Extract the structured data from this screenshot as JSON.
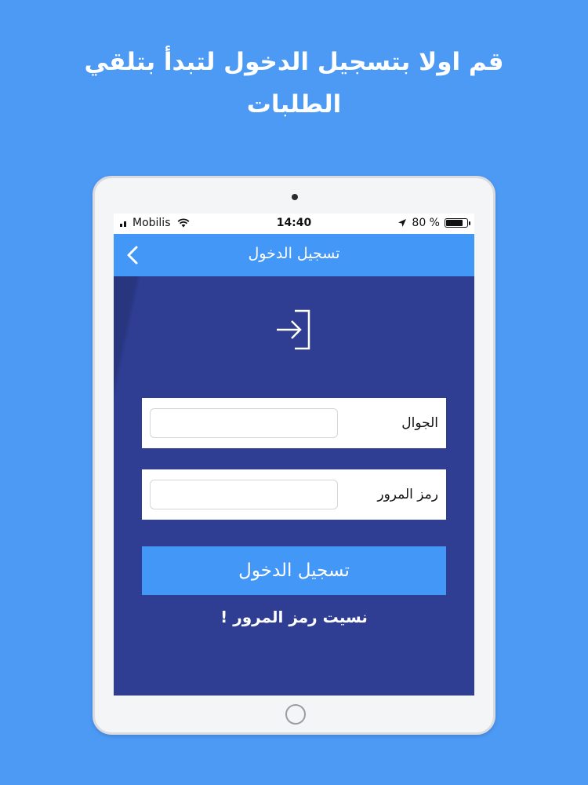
{
  "headline": {
    "line1": "قم اولا بتسجيل الدخول لتبدأ بتلقي",
    "line2": "الطلبات"
  },
  "status_bar": {
    "carrier": "Mobilis",
    "time": "14:40",
    "battery_text": "80 %",
    "battery_level": 0.8
  },
  "nav": {
    "title": "تسجيل الدخول",
    "back_icon": "chevron-left-icon"
  },
  "form": {
    "login_icon": "login-icon",
    "phone_label": "الجوال",
    "phone_value": "",
    "password_label": "رمز المرور",
    "password_value": "",
    "submit_label": "تسجيل الدخول",
    "forgot_label": "نسيت رمز المرور !"
  },
  "colors": {
    "background": "#4d9af5",
    "nav_bar": "#4397f7",
    "content": "#2f3d92",
    "button": "#4397f7"
  }
}
